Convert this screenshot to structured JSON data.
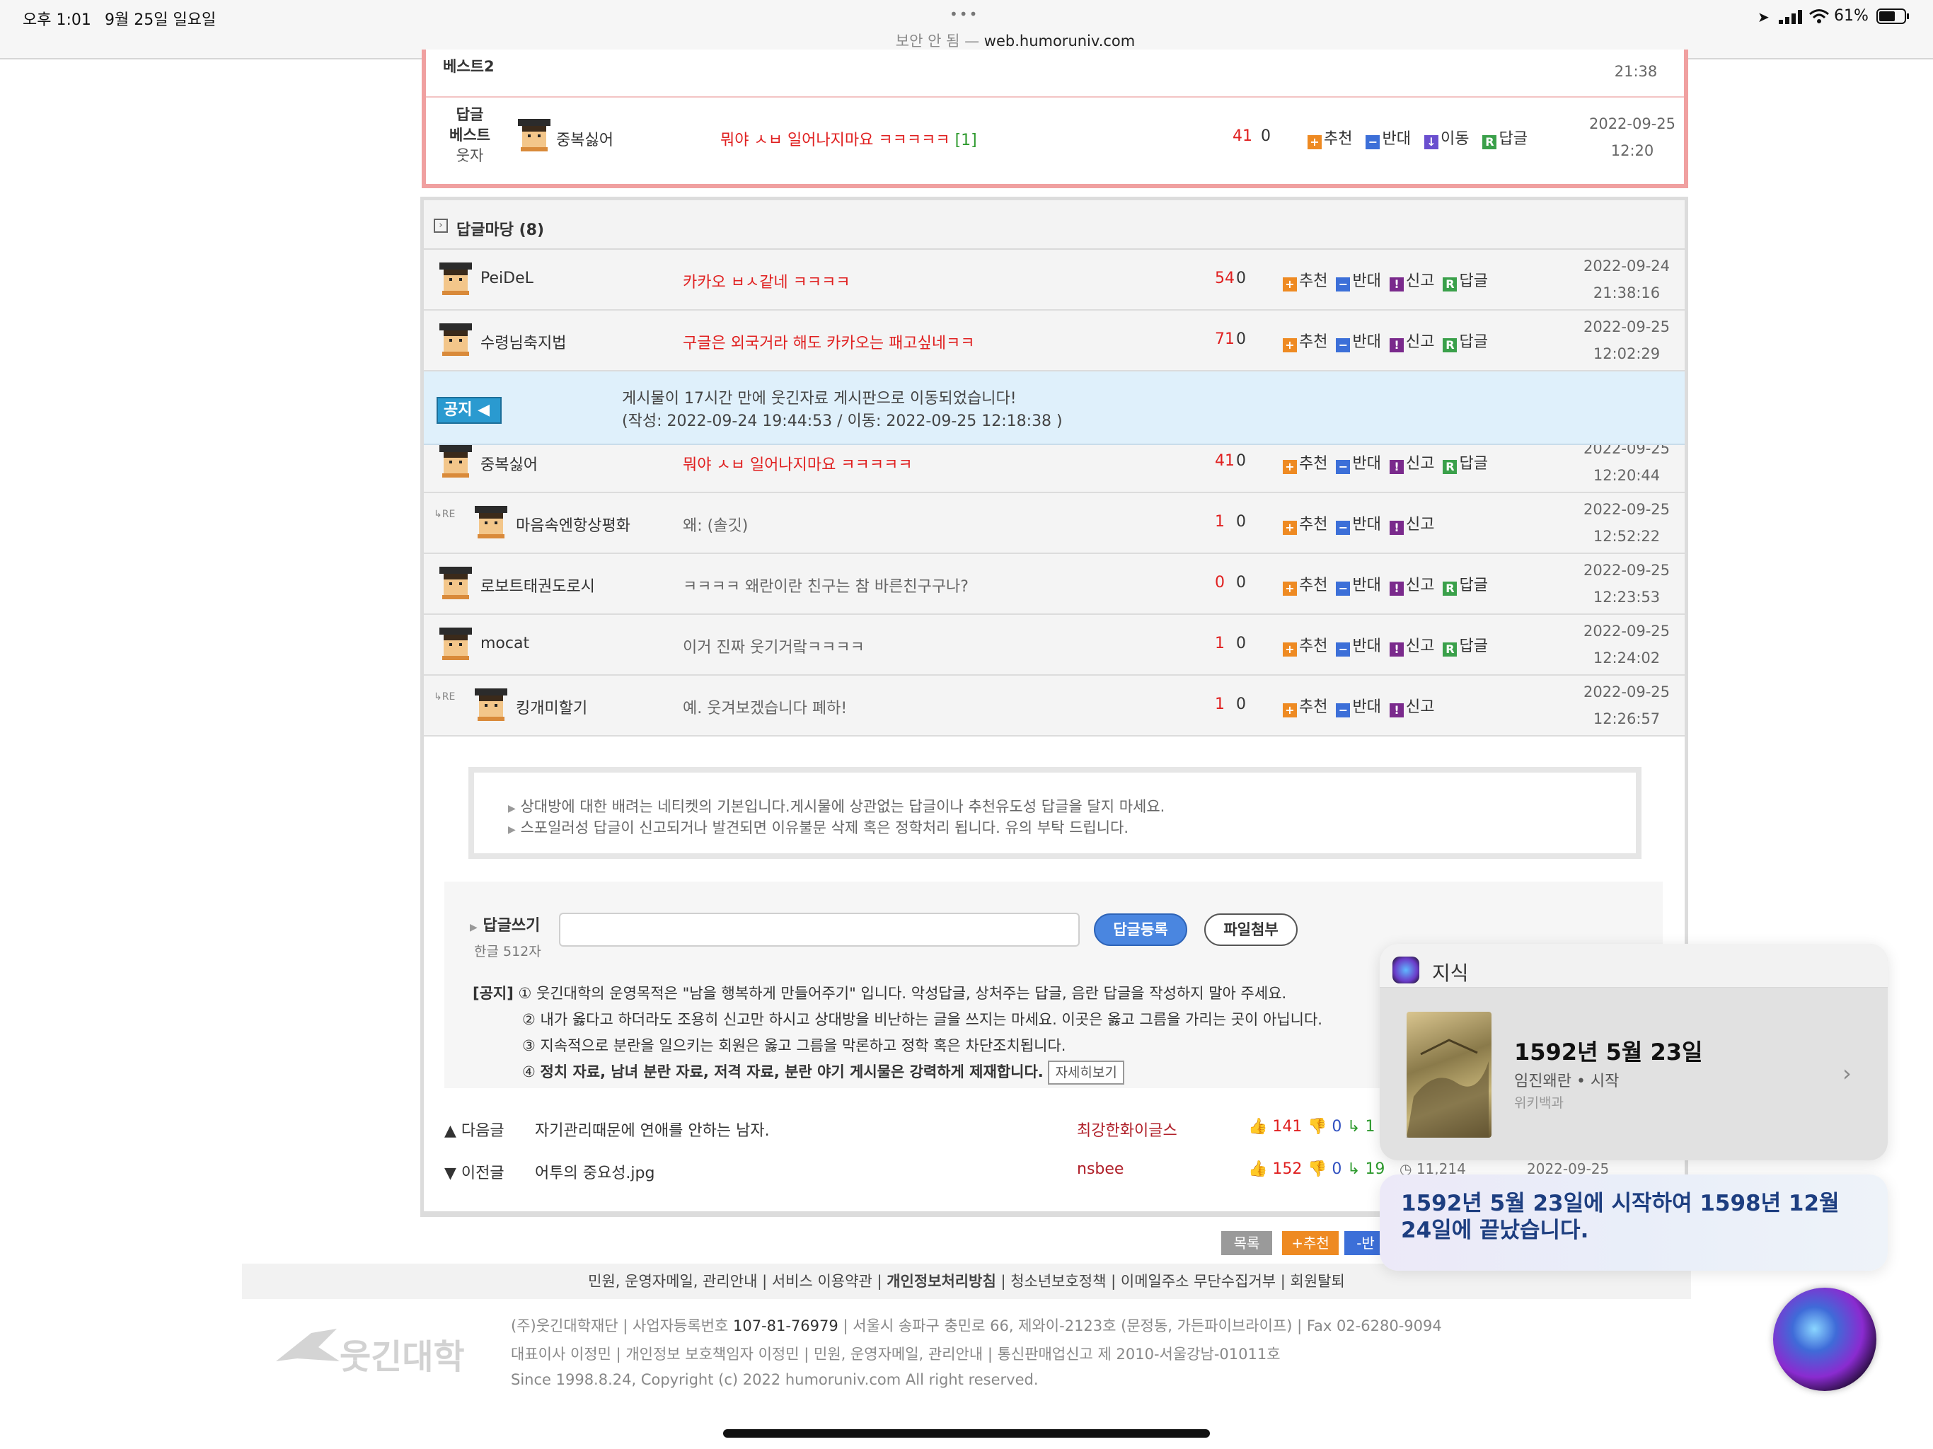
{
  "status_bar": {
    "time": "오후 1:01",
    "date": "9월 25일 일요일",
    "url_prefix": "보안 안 됨 —",
    "url": "web.humoruniv.com",
    "battery": "61%",
    "more_dots": "•••"
  },
  "best_box": {
    "rows": [
      {
        "rank": "베스트2",
        "date_time": "21:38"
      },
      {
        "rank_line1": "답글",
        "rank_line2": "베스트",
        "rank_line3": "웃자",
        "user": "중복싫어",
        "text": "뭐야 ㅅㅂ 일어나지마요 ㅋㅋㅋㅋㅋ",
        "reply_count": "[1]",
        "up": "41",
        "down": "0",
        "date": "2022-09-25",
        "time": "12:20"
      }
    ],
    "actions": {
      "recommend": "추천",
      "oppose": "반대",
      "move": "이동",
      "reply": "답글"
    }
  },
  "comments": {
    "header": "답글마당 (8)",
    "actions": {
      "recommend": "추천",
      "oppose": "반대",
      "report": "신고",
      "reply": "답글"
    },
    "re_label": "RE",
    "rows": [
      {
        "user": "PeiDeL",
        "text": "카카오 ㅂㅅ같네 ㅋㅋㅋㅋ",
        "up": "54",
        "down": "0",
        "date": "2022-09-24",
        "time": "21:38:16",
        "red": true
      },
      {
        "user": "수령님축지법",
        "text": "구글은 외국거라 해도 카카오는 패고싶네ㅋㅋ",
        "up": "71",
        "down": "0",
        "date": "2022-09-25",
        "time": "12:02:29",
        "red": true
      },
      {
        "user": "중복싫어",
        "text": "뭐야 ㅅㅂ 일어나지마요 ㅋㅋㅋㅋㅋ",
        "up": "41",
        "down": "0",
        "date": "2022-09-25",
        "time": "12:20:44",
        "red": true
      },
      {
        "user": "마음속엔항상평화",
        "text": "왜: (솔깃)",
        "up": "1",
        "down": "0",
        "date": "2022-09-25",
        "time": "12:52:22",
        "red": false
      },
      {
        "user": "로보트태권도로시",
        "text": "ㅋㅋㅋㅋ 왜란이란 친구는 참 바른친구구나?",
        "up": "0",
        "down": "0",
        "date": "2022-09-25",
        "time": "12:23:53",
        "red": false
      },
      {
        "user": "mocat",
        "text": "이거 진짜 웃기거랔ㅋㅋㅋㅋ",
        "up": "1",
        "down": "0",
        "date": "2022-09-25",
        "time": "12:24:02",
        "red": false
      },
      {
        "user": "킹개미할기",
        "text": "예. 웃겨보겠습니다 폐하!",
        "up": "1",
        "down": "0",
        "date": "2022-09-25",
        "time": "12:26:57",
        "red": false
      }
    ],
    "notice": {
      "badge": "공지",
      "line1": "게시물이 17시간 만에 웃긴자료 게시판으로 이동되었습니다!",
      "line2": "(작성: 2022-09-24 19:44:53 / 이동: 2022-09-25 12:18:38 )"
    }
  },
  "guide": {
    "line1": "상대방에 대한 배려는 네티켓의 기본입니다.게시물에 상관없는 답글이나 추천유도성 답글을 달지 마세요.",
    "line2": "스포일러성 답글이 신고되거나 발견되면 이유불문 삭제 혹은 정학처리 됩니다. 유의 부탁 드립니다."
  },
  "write": {
    "label": "답글쓰기",
    "limit": "한글 512자",
    "input_value": "",
    "submit": "답글등록",
    "attach": "파일첨부",
    "notice_label": "[공지]",
    "notice1": "① 웃긴대학의 운영목적은 \"남을 행복하게 만들어주기\" 입니다. 악성답글, 상처주는 답글, 음란 답글을 작성하지 말아 주세요.",
    "notice2": "② 내가 옳다고 하더라도 조용히 신고만 하시고 상대방을 비난하는 글을 쓰지는 마세요. 이곳은 옳고 그름을 가리는 곳이 아닙니다.",
    "notice3": "③ 지속적으로 분란을 일으키는 회원은 옳고 그름을 막론하고 정학 혹은 차단조치됩니다.",
    "notice4_prefix": "④",
    "notice4": "정치 자료, 남녀 분란 자료, 저격 자료, 분란 야기 게시물은 강력하게 제재합니다.",
    "more": "자세히보기"
  },
  "nav": {
    "next_label": "▲ 다음글",
    "next_title": "자기관리때문에 연애를 안하는 남자.",
    "next_author": "최강한화이글스",
    "next_up": "141",
    "next_down": "0",
    "next_reply": "1",
    "prev_label": "▼ 이전글",
    "prev_title": "어투의 중요성.jpg",
    "prev_author": "nsbee",
    "prev_up": "152",
    "prev_down": "0",
    "prev_reply": "19",
    "prev_views": "11,214",
    "prev_date": "2022-09-25 [12:05]"
  },
  "bottom_buttons": {
    "list": "목록",
    "recommend": "+추천",
    "oppose": "-반"
  },
  "footer": {
    "links": [
      "민원, 운영자메일, 관리안내",
      "서비스 이용약관",
      "개인정보처리방침",
      "청소년보호정책",
      "이메일주소 무단수집거부",
      "회원탈퇴"
    ],
    "logo_text": "웃긴대학",
    "line1_prefix": "(주)웃긴대학재단 | 사업자등록번호",
    "biz_no": "107-81-76979",
    "line1_suffix": "| 서울시 송파구 충민로 66, 제와이-2123호 (문정동, 가든파이브라이프) | Fax 02-6280-9094",
    "line2": "대표이사 이정민 | 개인정보 보호책임자 이정민 | 민원, 운영자메일, 관리안내 | 통신판매업신고 제 2010-서울강남-01011호",
    "line3": "Since 1998.8.24, Copyright (c) 2022 humoruniv.com All right reserved."
  },
  "siri": {
    "title": "지식",
    "date_title": "1592년 5월 23일",
    "subtitle": "임진왜란 • 시작",
    "source": "위키백과",
    "answer": "1592년 5월 23일에 시작하여 1598년 12월 24일에 끝났습니다."
  },
  "colors": {
    "accent_red": "#e02020",
    "best_border": "#f0a0a0",
    "notice_bg": "#dff0fb",
    "submit_blue": "#4a86e0"
  }
}
